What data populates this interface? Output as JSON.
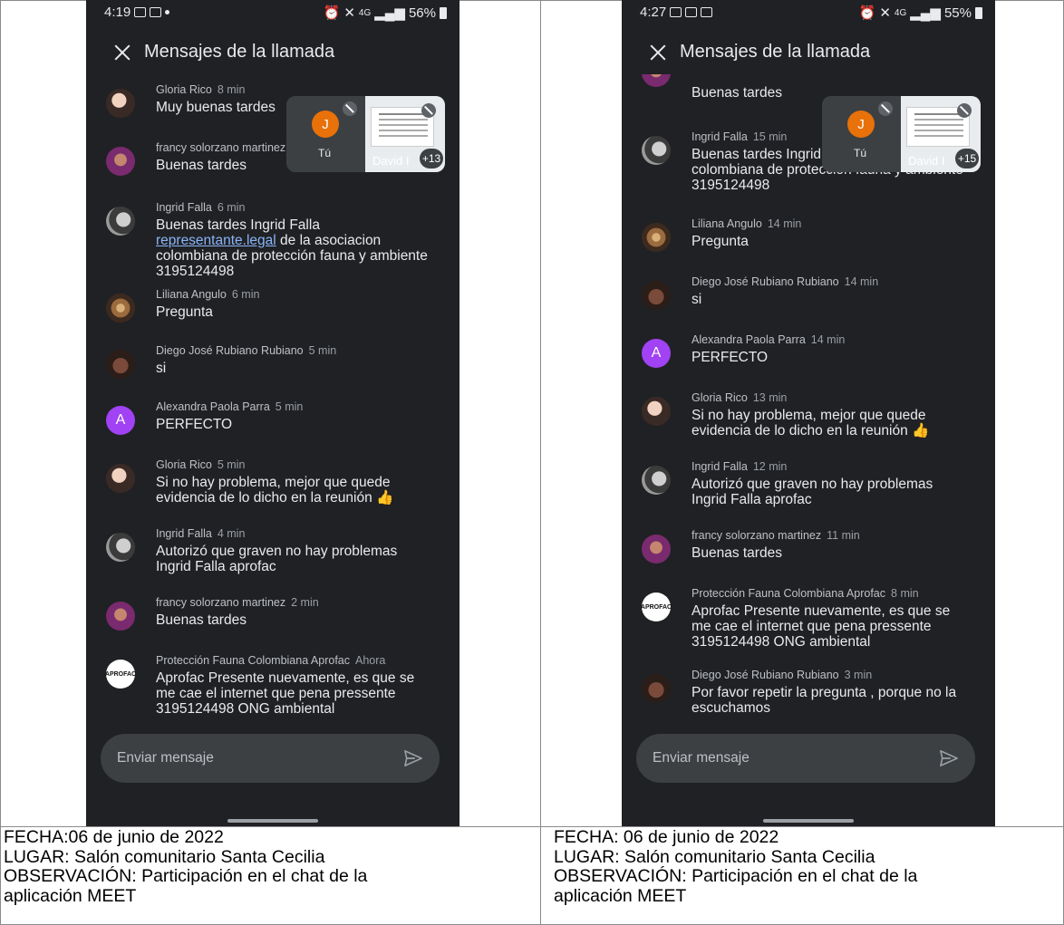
{
  "left": {
    "status": {
      "time": "4:19",
      "battery": "56%",
      "signal": "4G"
    },
    "title": "Mensajes de la llamada",
    "pip": {
      "self_initial": "J",
      "self_label": "Tú",
      "remote_name": "David I",
      "participants_more": "+13"
    },
    "messages": [
      {
        "sender": "Gloria Rico",
        "time": "8 min",
        "text": "Muy buenas tardes"
      },
      {
        "sender": "francy solorzano martinez",
        "time": "",
        "text": "Buenas tardes"
      },
      {
        "sender": "Ingrid Falla",
        "time": "6 min",
        "text_before": "Buenas tardes Ingrid Falla ",
        "link": "representante.legal",
        "text_after": " de la asociacion colombiana de protección fauna y ambiente 3195124498"
      },
      {
        "sender": "Liliana Angulo",
        "time": "6 min",
        "text": "Pregunta"
      },
      {
        "sender": "Diego José Rubiano Rubiano",
        "time": "5 min",
        "text": "si"
      },
      {
        "sender": "Alexandra Paola Parra",
        "time": "5 min",
        "text": "PERFECTO",
        "initial": "A"
      },
      {
        "sender": "Gloria Rico",
        "time": "5 min",
        "text": "Si no hay problema, mejor que quede evidencia de lo dicho en la reunión",
        "emoji": "👍"
      },
      {
        "sender": "Ingrid Falla",
        "time": "4 min",
        "text": "Autorizó que graven no hay problemas Ingrid Falla aprofac"
      },
      {
        "sender": "francy solorzano martinez",
        "time": "2 min",
        "text": "Buenas tardes"
      },
      {
        "sender": "Protección Fauna Colombiana Aprofac",
        "time": "Ahora",
        "text": "Aprofac Presente nuevamente, es que se me cae el internet que pena pressente 3195124498 ONG ambiental",
        "logo": "APROFAC"
      }
    ],
    "compose_placeholder": "Enviar mensaje"
  },
  "right": {
    "status": {
      "time": "4:27",
      "battery": "55%",
      "signal": "4G"
    },
    "title": "Mensajes de la llamada",
    "pip": {
      "self_initial": "J",
      "self_label": "Tú",
      "remote_name": "David I",
      "participants_more": "+15"
    },
    "messages": [
      {
        "sender": "",
        "time": "",
        "text": "Buenas tardes"
      },
      {
        "sender": "Ingrid Falla",
        "time": "15 min",
        "text": "Buenas tardes Ingrid de la asociacion colombiana de proteccion fauna y ambiente 3195124498"
      },
      {
        "sender": "Liliana Angulo",
        "time": "14 min",
        "text": "Pregunta"
      },
      {
        "sender": "Diego José Rubiano Rubiano",
        "time": "14 min",
        "text": "si"
      },
      {
        "sender": "Alexandra Paola Parra",
        "time": "14 min",
        "text": "PERFECTO",
        "initial": "A"
      },
      {
        "sender": "Gloria Rico",
        "time": "13 min",
        "text": "Si no hay problema, mejor que quede evidencia de lo dicho en la reunión",
        "emoji": "👍"
      },
      {
        "sender": "Ingrid Falla",
        "time": "12 min",
        "text": "Autorizó que graven no hay problemas Ingrid Falla aprofac"
      },
      {
        "sender": "francy solorzano martinez",
        "time": "11 min",
        "text": "Buenas tardes"
      },
      {
        "sender": "Protección Fauna Colombiana Aprofac",
        "time": "8 min",
        "text": "Aprofac Presente nuevamente, es que se me cae el internet que pena pressente 3195124498 ONG ambiental",
        "logo": "APROFAC"
      },
      {
        "sender": "Diego José Rubiano Rubiano",
        "time": "3 min",
        "text": "Por favor repetir la pregunta , porque no la escuchamos"
      }
    ],
    "compose_placeholder": "Enviar mensaje"
  },
  "captions": {
    "left": {
      "fecha": "FECHA:06 de junio de 2022",
      "lugar": "LUGAR: Salón comunitario Santa Cecilia",
      "observacion_1": "OBSERVACIÓN: Participación en el chat de la",
      "observacion_2": "aplicación MEET"
    },
    "right": {
      "fecha": "FECHA: 06 de junio de 2022",
      "lugar": "LUGAR: Salón comunitario Santa Cecilia",
      "observacion_1": "OBSERVACIÓN: Participación en el chat de la",
      "observacion_2": "aplicación MEET"
    }
  }
}
